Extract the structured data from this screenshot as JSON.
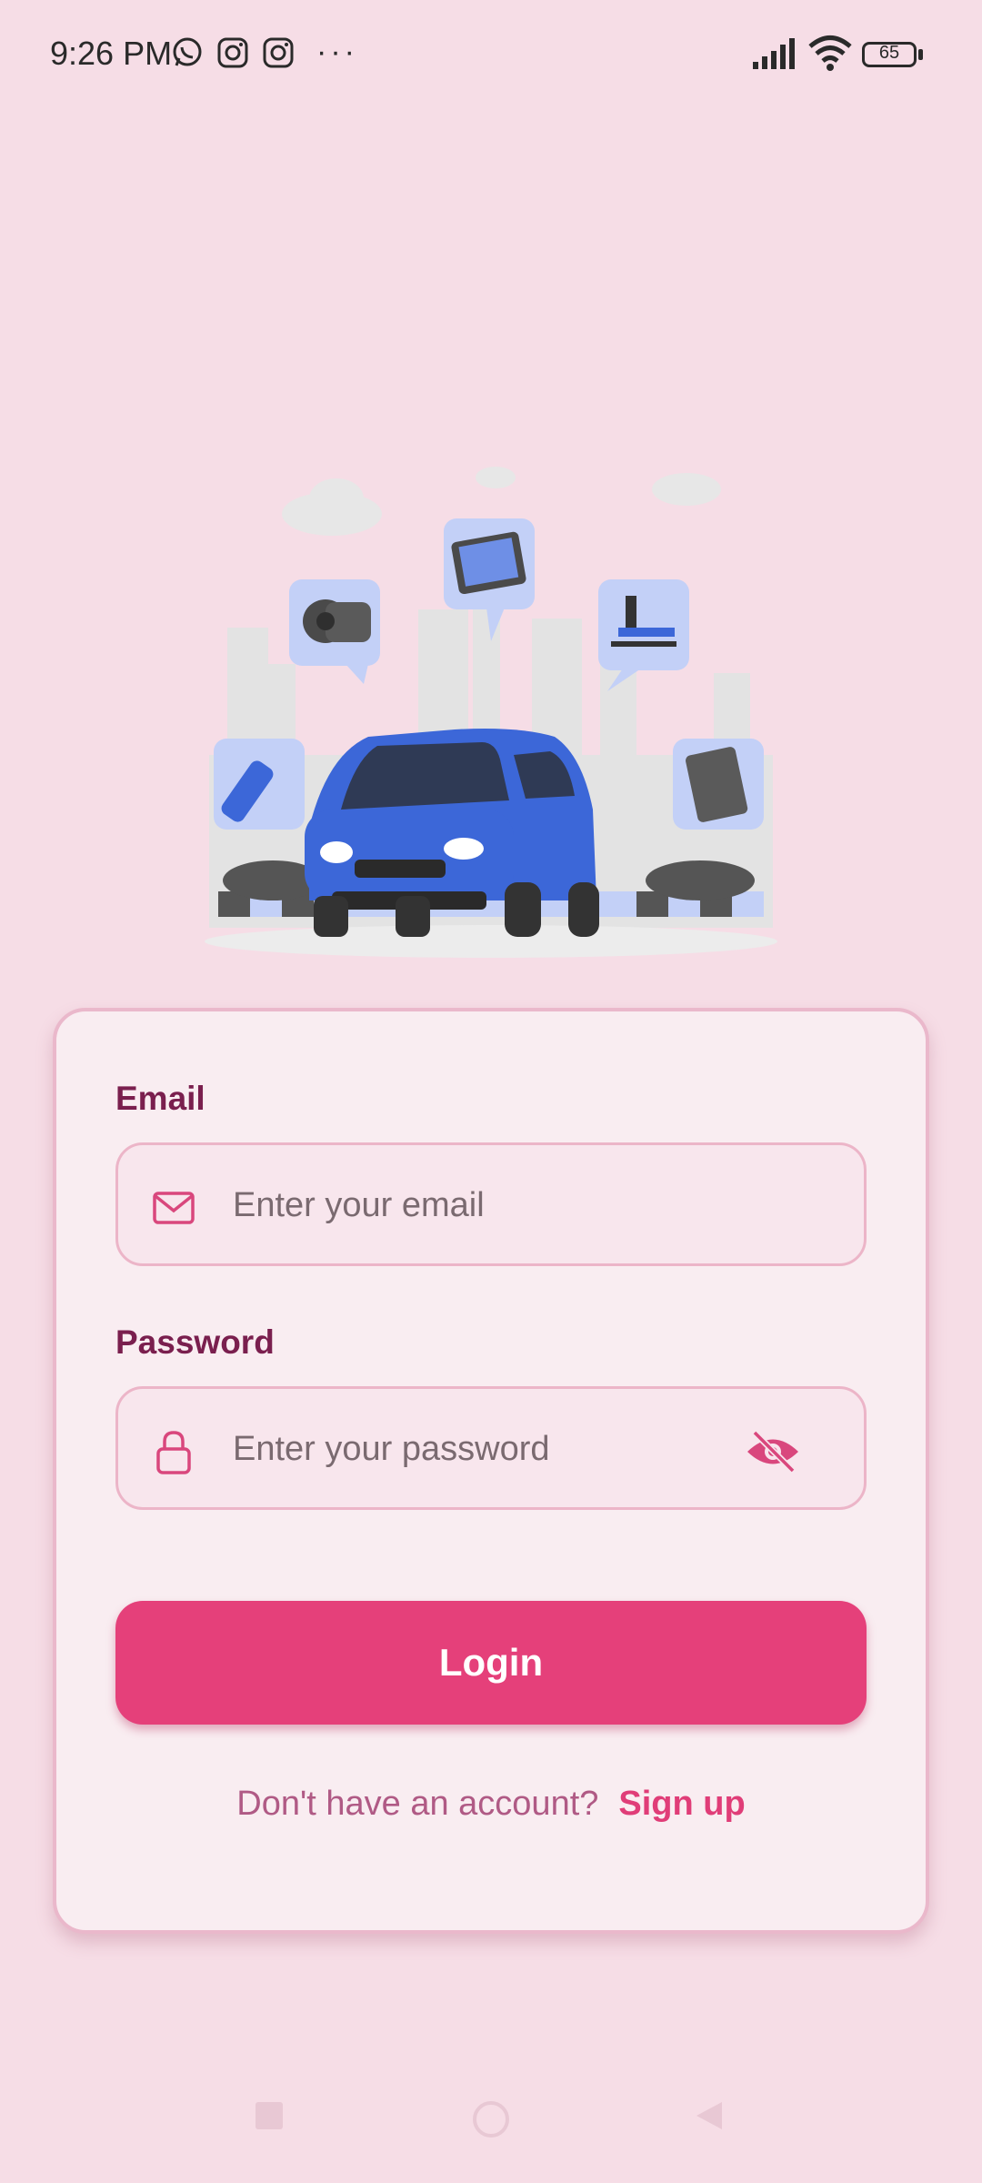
{
  "status_bar": {
    "time": "9:26 PM",
    "notification_icons": [
      "whatsapp-icon",
      "instagram-icon",
      "instagram-icon"
    ],
    "more": "···",
    "battery_level": "65"
  },
  "illustration": {
    "description_icon": "car-service-illustration",
    "car_color": "#3c67d8",
    "accent_color": "#bccaf5"
  },
  "login_form": {
    "email_label": "Email",
    "email_placeholder": "Enter your email",
    "password_label": "Password",
    "password_placeholder": "Enter your password",
    "login_button": "Login",
    "signup_prompt": "Don't have an account?",
    "signup_link": "Sign up"
  },
  "colors": {
    "background": "#f6dde6",
    "primary": "#e5407a",
    "label": "#7a1f4e",
    "field_border": "#ecb5c8"
  }
}
